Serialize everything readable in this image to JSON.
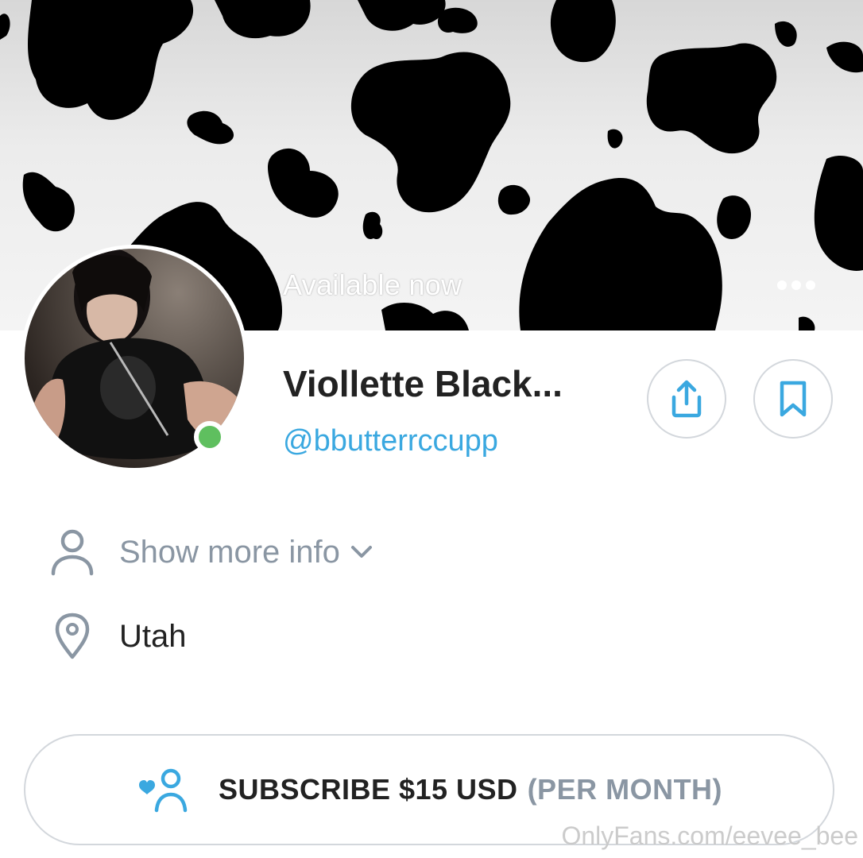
{
  "banner": {
    "status_text": "Available now",
    "menu_icon": "more-dots-icon"
  },
  "profile": {
    "display_name": "Viollette Black...",
    "handle": "@bbutterrccupp",
    "online": true,
    "online_color": "#5fbf5f",
    "share_icon": "share-upload-icon",
    "bookmark_icon": "bookmark-icon"
  },
  "info": {
    "more_info_label": "Show more info",
    "more_info_icon": "person-icon",
    "location_icon": "map-pin-icon",
    "location": "Utah"
  },
  "subscribe": {
    "label": "SUBSCRIBE $15 USD",
    "period": "(PER MONTH)",
    "icon": "heart-user-icon"
  },
  "watermark": "OnlyFans.com/eevee_bee",
  "colors": {
    "accent": "#3aa8e0",
    "muted_text": "#8a96a3",
    "border": "#d3d7dc",
    "text": "#222222"
  }
}
